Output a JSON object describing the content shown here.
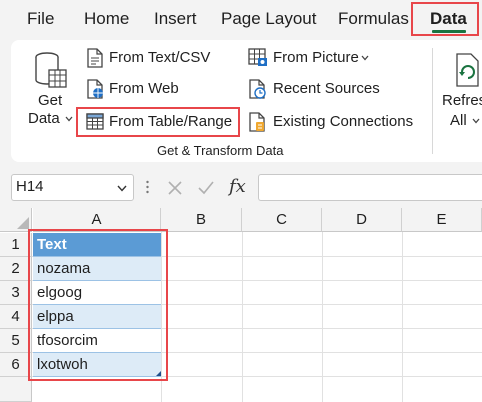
{
  "menu": {
    "tabs": [
      "File",
      "Home",
      "Insert",
      "Page Layout",
      "Formulas",
      "Data"
    ],
    "active_tab": "Data"
  },
  "ribbon": {
    "get_data": {
      "line1": "Get",
      "line2": "Data"
    },
    "from_text_csv": "From Text/CSV",
    "from_web": "From Web",
    "from_table_range": "From Table/Range",
    "from_picture": "From Picture",
    "recent_sources": "Recent Sources",
    "existing_connections": "Existing Connections",
    "group_label": "Get & Transform Data",
    "refresh_all": {
      "line1": "Refres",
      "line2": "All"
    }
  },
  "formula_bar": {
    "name_box": "H14",
    "fx_label": "fx",
    "formula": ""
  },
  "grid": {
    "columns": [
      "A",
      "B",
      "C",
      "D",
      "E"
    ],
    "rows": [
      "1",
      "2",
      "3",
      "4",
      "5",
      "6"
    ],
    "table_header": "Text",
    "table_values": [
      "nozama",
      "elgoog",
      "elppa",
      "tfosorcim",
      "lxotwoh"
    ]
  },
  "colors": {
    "highlight": "#e8464a",
    "table_header": "#5b9bd5",
    "table_band": "#ddebf7",
    "accent_green": "#1a7340"
  },
  "icons": {
    "get_data": "database-table-icon",
    "from_text_csv": "text-file-icon",
    "from_web": "web-page-icon",
    "from_table_range": "table-icon",
    "from_picture": "picture-table-icon",
    "recent_sources": "clock-document-icon",
    "existing_connections": "connections-document-icon",
    "refresh_all": "refresh-icon"
  }
}
